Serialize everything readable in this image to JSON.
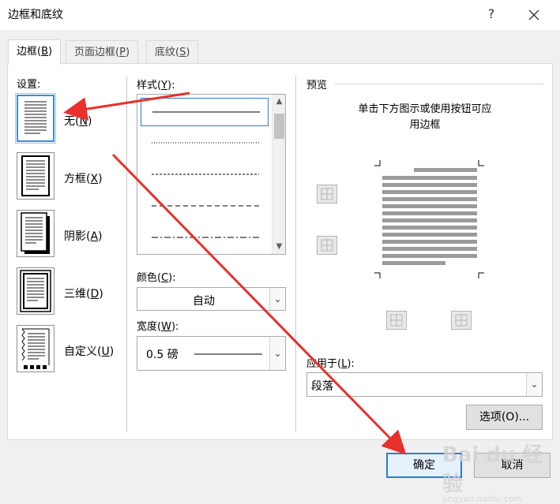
{
  "window": {
    "title": "边框和底纹",
    "help": "?"
  },
  "tabs": [
    {
      "label": "边框",
      "key": "B"
    },
    {
      "label": "页面边框",
      "key": "P"
    },
    {
      "label": "底纹",
      "key": "S"
    }
  ],
  "settings": {
    "header": "设置:",
    "items": [
      {
        "label": "无",
        "key": "N"
      },
      {
        "label": "方框",
        "key": "X"
      },
      {
        "label": "阴影",
        "key": "A"
      },
      {
        "label": "三维",
        "key": "D"
      },
      {
        "label": "自定义",
        "key": "U"
      }
    ],
    "selected": "无"
  },
  "style": {
    "header": "样式",
    "key": "Y"
  },
  "color": {
    "header": "颜色",
    "key": "C",
    "value": "自动"
  },
  "width": {
    "header": "宽度",
    "key": "W",
    "value": "0.5 磅"
  },
  "preview": {
    "header": "预览",
    "hint_line1": "单击下方图示或使用按钮可应",
    "hint_line2": "用边框"
  },
  "apply_to": {
    "header": "应用于",
    "key": "L",
    "value": "段落"
  },
  "buttons": {
    "options": "选项(O)...",
    "ok": "确定",
    "cancel": "取消"
  },
  "watermark": {
    "main": "Bai du 经验",
    "sub": "jingyan.baidu.com"
  },
  "colors": {
    "accent": "#2d7bd3",
    "annotation_arrow": "#e8302c"
  }
}
